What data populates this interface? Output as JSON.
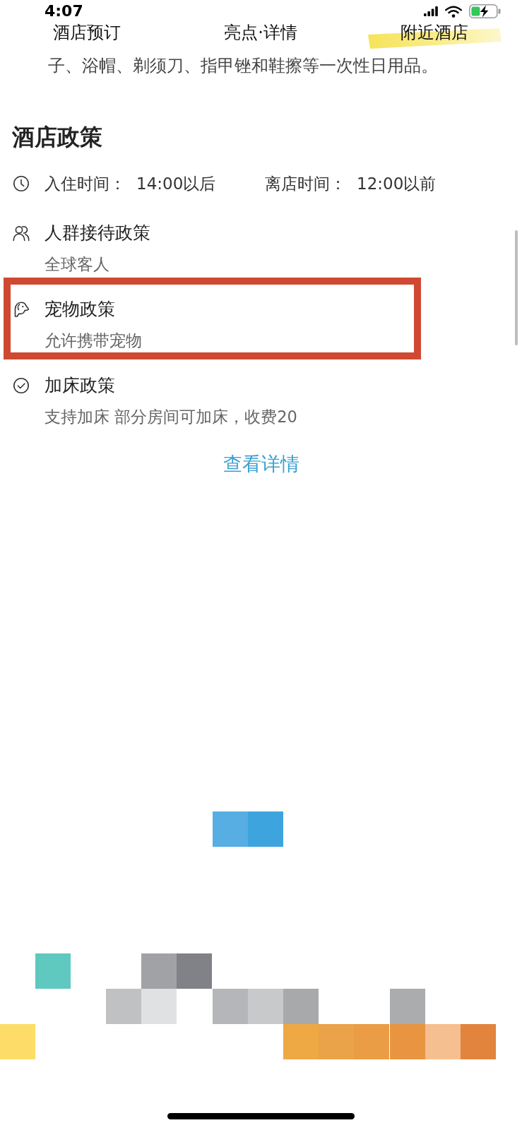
{
  "status_bar": {
    "time": "4:07"
  },
  "nav_tabs": [
    {
      "label": "酒店预订",
      "highlighted": false
    },
    {
      "label": "亮点·详情",
      "highlighted": false
    },
    {
      "label": "附近酒店",
      "highlighted": true
    }
  ],
  "hotel_policy": {
    "note": "子、浴帽、剃须刀、指甲锉和鞋擦等一次性日用品。",
    "title": "酒店政策",
    "check_in": {
      "label": "入住时间：",
      "value": "14:00以后"
    },
    "check_out": {
      "label": "离店时间：",
      "value": "12:00以前"
    },
    "items": [
      {
        "kind": "guests",
        "title": "人群接待政策",
        "detail": "全球客人",
        "framed": false
      },
      {
        "kind": "pets",
        "title": "宠物政策",
        "detail": "允许携带宠物",
        "framed": true
      },
      {
        "kind": "extra_bed",
        "title": "加床政策",
        "detail": "支持加床 部分房间可加床，收费20",
        "framed": false
      }
    ],
    "more_link": "查看详情"
  }
}
